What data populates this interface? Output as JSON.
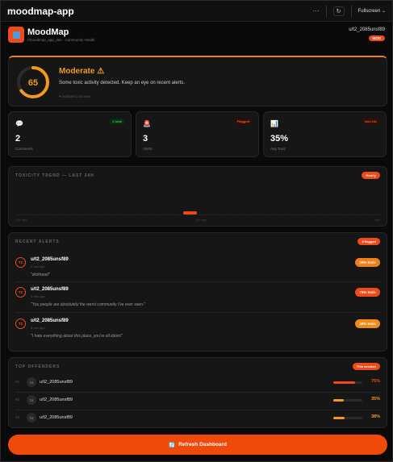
{
  "window": {
    "title": "moodmap-app",
    "more_label": "···",
    "fullscreen_label": "Fullscreen",
    "chevron": "⌄"
  },
  "header": {
    "brand": "MoodMap",
    "subtitle": "r/moodmap_app_dev · Community Health",
    "username": "u/t2_2085unsf89",
    "mod_badge": "MOD"
  },
  "mood": {
    "score": 65,
    "score_fraction": 0.65,
    "title": "Moderate",
    "warning_icon": "⚠",
    "description": "Some toxic activity detected. Keep an eye on recent alerts.",
    "updated_icon": "●",
    "updated": "Updated just now",
    "accent": "#f39a1e"
  },
  "stats": [
    {
      "icon": "💬",
      "value": "2",
      "label": "Comments",
      "tag": "2 total",
      "tag_color": "#22c55e"
    },
    {
      "icon": "🚨",
      "value": "3",
      "label": "Alerts",
      "tag": "Flagged",
      "tag_color": "#ff4a1a"
    },
    {
      "icon": "📊",
      "value": "35%",
      "label": "Avg Toxic",
      "tag": "last 24h",
      "tag_color": "#ff4a1a"
    }
  ],
  "trend": {
    "title": "TOXICITY TREND — LAST 24H",
    "badge": "Hourly",
    "axis_labels": [
      "24h ago",
      "12h ago",
      "now"
    ]
  },
  "chart_data": {
    "type": "bar",
    "title": "TOXICITY TREND — LAST 24H",
    "x": "hours (24h ago → now)",
    "bar_count": 24,
    "values_note": "single visible spike",
    "values": [
      0,
      0,
      0,
      0,
      0,
      0,
      0,
      0,
      0,
      0,
      0,
      0.35,
      0,
      0,
      0,
      0,
      0,
      0,
      0,
      0,
      0,
      0,
      0,
      0
    ],
    "accent": "#f04a1a"
  },
  "alerts": {
    "title": "RECENT ALERTS",
    "badge": "3 flagged",
    "items": [
      {
        "avatar": "T2",
        "user": "u/t2_2085unsf89",
        "time": "2 min ago",
        "text": "\"dickhead\"",
        "score": "35% toxic",
        "color": "#f07f1a"
      },
      {
        "avatar": "T2",
        "user": "u/t2_2085unsf89",
        "time": "5 min ago",
        "text": "\"You people are absolutely the worst community I've ever seen.\"",
        "score": "75% toxic",
        "color": "#f04a1a"
      },
      {
        "avatar": "T2",
        "user": "u/t2_2085unsf89",
        "time": "8 min ago",
        "text": "\"I hate everything about this place, you're all idiots!\"",
        "score": "38% toxic",
        "color": "#f08a1a"
      }
    ]
  },
  "offenders": {
    "title": "TOP OFFENDERS",
    "badge": "This session",
    "items": [
      {
        "rank": "#1",
        "avatar": "T2",
        "user": "u/t2_2085unsf89",
        "pct": "75%",
        "fraction": 0.75,
        "color": "#f04a1a"
      },
      {
        "rank": "#2",
        "avatar": "T2",
        "user": "u/t2_2085unsf89",
        "pct": "35%",
        "fraction": 0.35,
        "color": "#f39a1e"
      },
      {
        "rank": "#3",
        "avatar": "T2",
        "user": "u/t2_2085unsf89",
        "pct": "38%",
        "fraction": 0.38,
        "color": "#f39a1e"
      }
    ]
  },
  "refresh": {
    "icon": "🔄",
    "label": "Refresh Dashboard"
  }
}
